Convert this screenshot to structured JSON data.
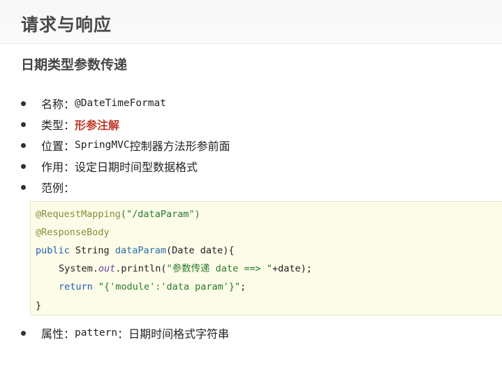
{
  "header": {
    "title": "请求与响应"
  },
  "section": {
    "title": "日期类型参数传递"
  },
  "bullets": {
    "name_label": "名称：",
    "name_value": "@DateTimeFormat",
    "type_label": "类型：",
    "type_value": "形参注解",
    "position_label": "位置：",
    "position_mono": "SpringMVC",
    "position_text": "控制器方法形参前面",
    "effect_label": "作用：",
    "effect_value": "设定日期时间型数据格式",
    "example_label": "范例：",
    "attr_label": "属性：",
    "attr_mono": "pattern",
    "attr_text": "：日期时间格式字符串"
  },
  "code": {
    "l1_ann": "@RequestMapping",
    "l1_str": "(\"/dataParam\")",
    "l2_ann": "@ResponseBody",
    "l3_kw": "public",
    "l3_type": " String ",
    "l3_fn": "dataParam",
    "l3_rest": "(Date date){",
    "l4_a": "System.",
    "l4_it": "out",
    "l4_b": ".println(",
    "l4_str": "\"参数传递 date ==> \"",
    "l4_c": "+date);",
    "l5_kw": "return",
    "l5_str": "\"{'module':'data param'}\"",
    "l5_c": ";",
    "l6": "}"
  }
}
